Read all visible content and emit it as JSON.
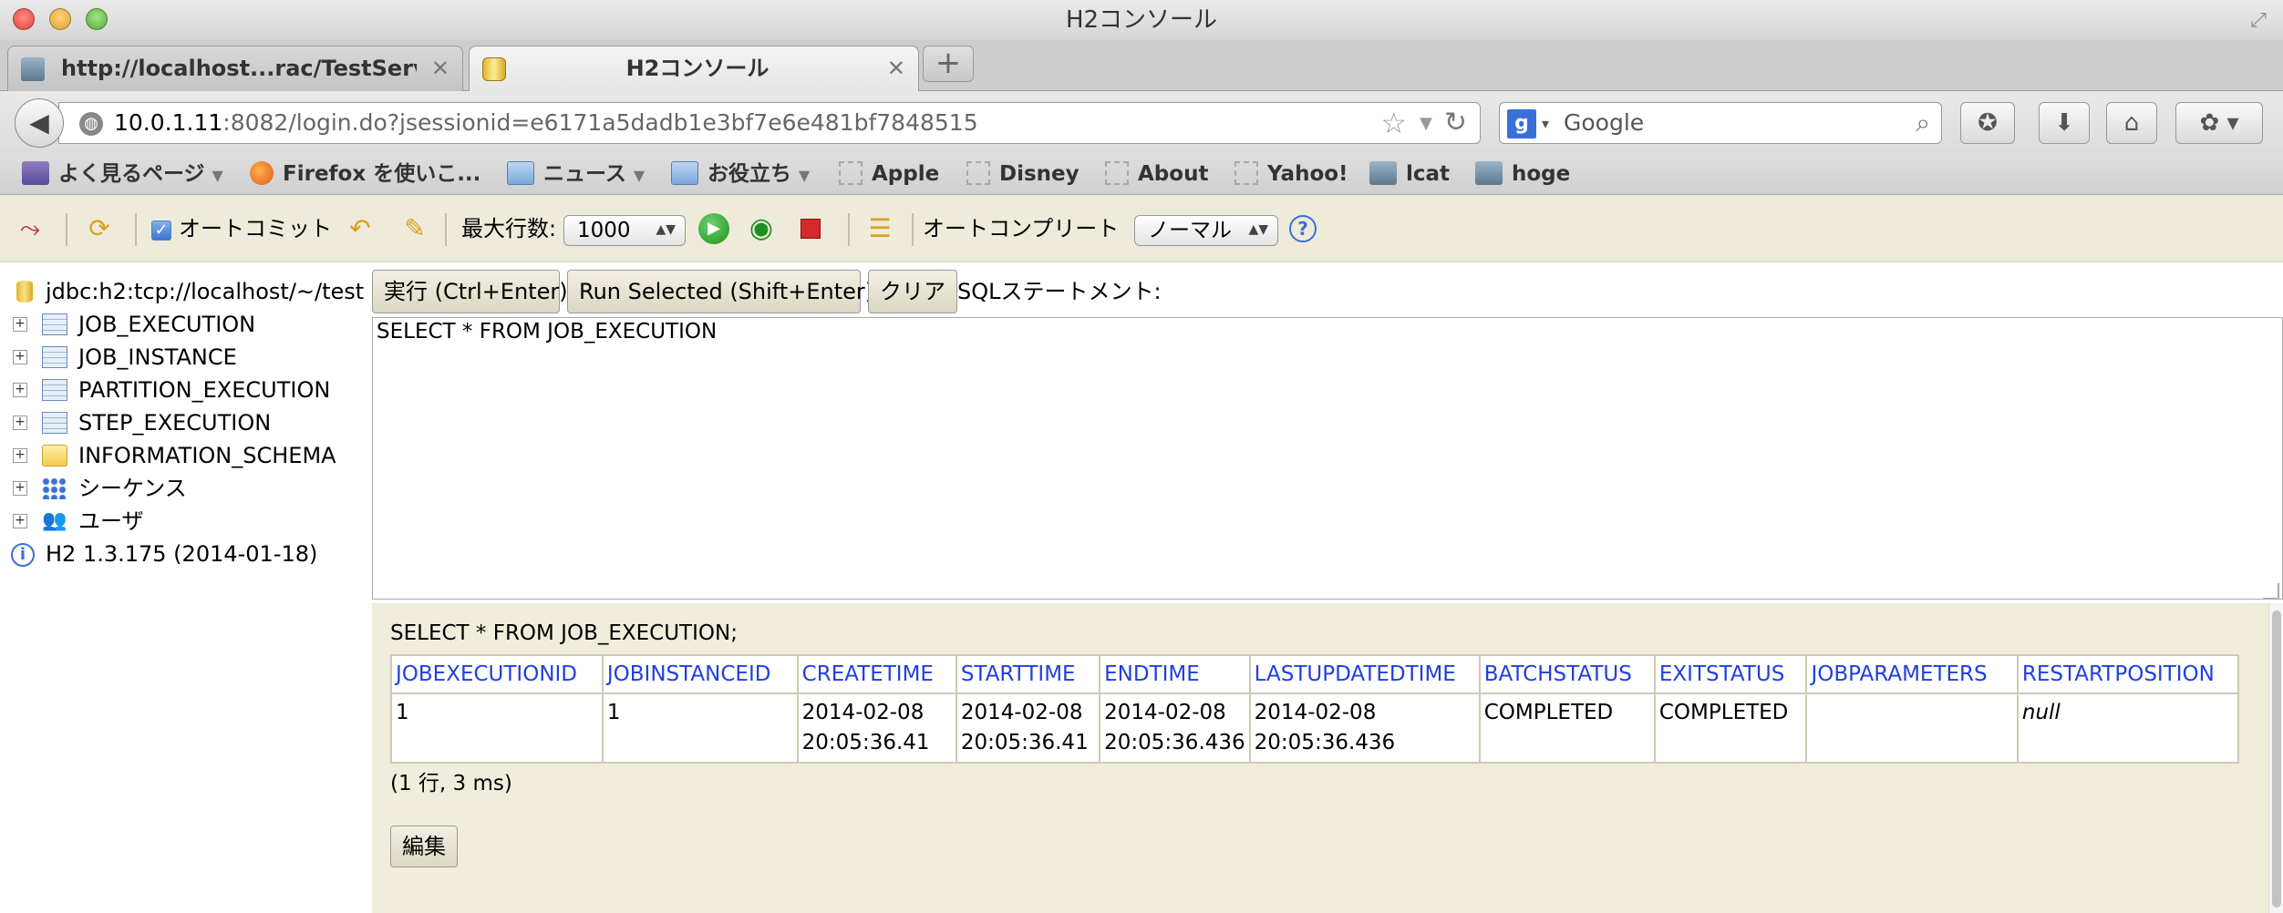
{
  "window": {
    "title": "H2コンソール"
  },
  "tabs": [
    {
      "label": "http://localhost...rac/TestServlet",
      "active": false,
      "icon": "network-icon"
    },
    {
      "label": "H2コンソール",
      "active": true,
      "icon": "h2-database-icon"
    }
  ],
  "navbar": {
    "url_host": "10.0.1.11",
    "url_rest": ":8082/login.do?jsessionid=e6171a5dadb1e3bf7e6e481bf7848515",
    "search_placeholder": "Google"
  },
  "bookmarks": [
    {
      "label": "よく見るページ",
      "icon": "most-visited-icon",
      "dropdown": true
    },
    {
      "label": "Firefox を使いこ...",
      "icon": "firefox-icon",
      "dropdown": false
    },
    {
      "label": "ニュース",
      "icon": "folder-icon",
      "dropdown": true
    },
    {
      "label": "お役立ち",
      "icon": "folder-icon",
      "dropdown": true
    },
    {
      "label": "Apple",
      "icon": "bookmark-placeholder-icon",
      "dropdown": false
    },
    {
      "label": "Disney",
      "icon": "bookmark-placeholder-icon",
      "dropdown": false
    },
    {
      "label": "About",
      "icon": "bookmark-placeholder-icon",
      "dropdown": false
    },
    {
      "label": "Yahoo!",
      "icon": "bookmark-placeholder-icon",
      "dropdown": false
    },
    {
      "label": "lcat",
      "icon": "network-icon",
      "dropdown": false
    },
    {
      "label": "hoge",
      "icon": "network-icon",
      "dropdown": false
    }
  ],
  "h2toolbar": {
    "autocommit_label": "オートコミット",
    "autocommit_checked": true,
    "max_rows_label": "最大行数:",
    "max_rows_value": "1000",
    "autocomplete_label": "オートコンプリート",
    "autocomplete_value": "ノーマル"
  },
  "tree": {
    "connection": "jdbc:h2:tcp://localhost/~/test",
    "items": [
      {
        "label": "JOB_EXECUTION",
        "icon": "table-icon"
      },
      {
        "label": "JOB_INSTANCE",
        "icon": "table-icon"
      },
      {
        "label": "PARTITION_EXECUTION",
        "icon": "table-icon"
      },
      {
        "label": "STEP_EXECUTION",
        "icon": "table-icon"
      },
      {
        "label": "INFORMATION_SCHEMA",
        "icon": "folder-icon"
      },
      {
        "label": "シーケンス",
        "icon": "sequence-icon"
      },
      {
        "label": "ユーザ",
        "icon": "users-icon"
      }
    ],
    "version": "H2 1.3.175 (2014-01-18)"
  },
  "query": {
    "run_label": "実行 (Ctrl+Enter)",
    "run_selected_label": "Run Selected (Shift+Enter)",
    "clear_label": "クリア",
    "statement_label": "SQLステートメント:",
    "sql_text": "SELECT * FROM JOB_EXECUTION"
  },
  "results": {
    "executed_sql": "SELECT * FROM JOB_EXECUTION;",
    "columns": [
      "JOBEXECUTIONID",
      "JOBINSTANCEID",
      "CREATETIME",
      "STARTTIME",
      "ENDTIME",
      "LASTUPDATEDTIME",
      "BATCHSTATUS",
      "EXITSTATUS",
      "JOBPARAMETERS",
      "RESTARTPOSITION"
    ],
    "rows": [
      {
        "JOBEXECUTIONID": "1",
        "JOBINSTANCEID": "1",
        "CREATETIME_date": "2014-02-08",
        "CREATETIME_time": "20:05:36.41",
        "STARTTIME_date": "2014-02-08",
        "STARTTIME_time": "20:05:36.41",
        "ENDTIME_date": "2014-02-08",
        "ENDTIME_time": "20:05:36.436",
        "LASTUPDATEDTIME_date": "2014-02-08",
        "LASTUPDATEDTIME_time": "20:05:36.436",
        "BATCHSTATUS": "COMPLETED",
        "EXITSTATUS": "COMPLETED",
        "JOBPARAMETERS": "",
        "RESTARTPOSITION": "null"
      }
    ],
    "row_count_text": "(1 行, 3 ms)",
    "edit_label": "編集"
  },
  "colors": {
    "toolbar_bg": "#eeebdb",
    "results_bg": "#f1eddc",
    "column_header_text": "#1f3fe0"
  }
}
